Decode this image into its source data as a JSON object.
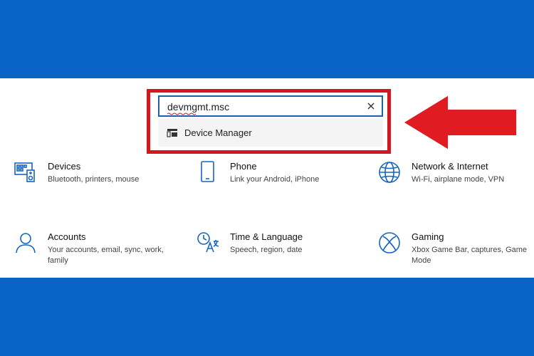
{
  "search": {
    "value": "devmgmt.msc",
    "suggestion": "Device Manager"
  },
  "tiles": [
    {
      "title": "Devices",
      "description": "Bluetooth, printers, mouse",
      "icon": "devices-icon"
    },
    {
      "title": "Phone",
      "description": "Link your Android, iPhone",
      "icon": "phone-icon"
    },
    {
      "title": "Network & Internet",
      "description": "Wi-Fi, airplane mode, VPN",
      "icon": "globe-icon"
    },
    {
      "title": "Accounts",
      "description": "Your accounts, email, sync, work, family",
      "icon": "person-icon"
    },
    {
      "title": "Time & Language",
      "description": "Speech, region, date",
      "icon": "time-language-icon"
    },
    {
      "title": "Gaming",
      "description": "Xbox Game Bar, captures, Game Mode",
      "icon": "xbox-icon"
    }
  ],
  "colors": {
    "accent": "#0a64c8",
    "icon_blue": "#1565c0",
    "highlight_red": "#d4161d"
  }
}
